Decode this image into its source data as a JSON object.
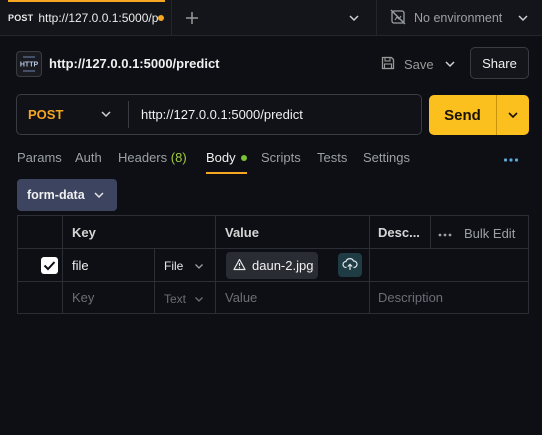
{
  "tabbar": {
    "active_tab": {
      "method": "POST",
      "title": "http://127.0.0.1:5000/p",
      "unsaved": true
    },
    "environment": "No environment",
    "icons": [
      "plus-icon",
      "chevron-down-icon",
      "no-environment-icon"
    ]
  },
  "request": {
    "title": "http://127.0.0.1:5000/predict",
    "save_label": "Save",
    "share_label": "Share"
  },
  "urlbar": {
    "method": "POST",
    "url": "http://127.0.0.1:5000/predict",
    "send_label": "Send"
  },
  "subtabs": {
    "params": "Params",
    "auth": "Auth",
    "headers": "Headers",
    "headers_count": "(8)",
    "body": "Body",
    "scripts": "Scripts",
    "tests": "Tests",
    "settings": "Settings"
  },
  "body": {
    "type": "form-data",
    "table": {
      "headers": {
        "key": "Key",
        "value": "Value",
        "description": "Desc...",
        "bulk_edit": "Bulk Edit"
      },
      "rows": [
        {
          "checked": true,
          "key": "file",
          "type": "File",
          "value": "daun-2.jpg"
        }
      ],
      "empty_row": {
        "key": "Key",
        "type": "Text",
        "value": "Value",
        "description": "Description"
      }
    }
  },
  "colors": {
    "accent": "#f5a623",
    "send": "#fbbf1e",
    "background": "#0e0f14",
    "body_type_bg": "#3c4460",
    "count_green": "#9fcb3d"
  }
}
